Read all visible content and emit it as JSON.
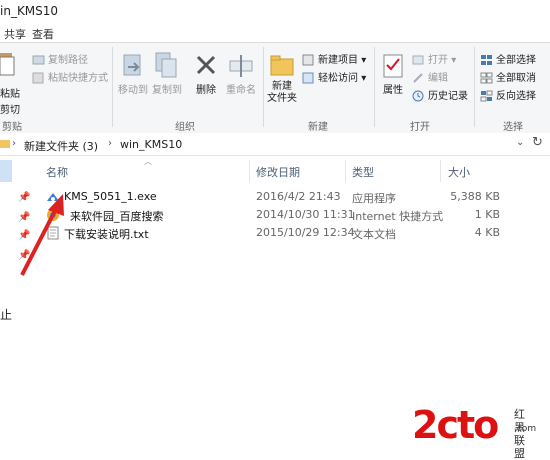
{
  "window": {
    "title": "in_KMS10"
  },
  "menu": {
    "tabs": [
      "共享",
      "查看"
    ]
  },
  "ribbon": {
    "clipboard": {
      "paste_label": "粘贴",
      "cut_label": "剪切",
      "copy_path_label": "复制路径",
      "paste_shortcut_label": "粘贴快捷方式",
      "group_label": "剪贴板"
    },
    "organize": {
      "move_to_label": "移动到",
      "copy_to_label": "复制到",
      "delete_label": "删除",
      "rename_label": "重命名",
      "group_label": "组织"
    },
    "new": {
      "new_folder_label": "新建\n文件夹",
      "new_item_label": "新建项目",
      "easy_access_label": "轻松访问",
      "group_label": "新建"
    },
    "open": {
      "properties_label": "属性",
      "open_label": "打开",
      "edit_label": "编辑",
      "history_label": "历史记录",
      "group_label": "打开"
    },
    "select": {
      "select_all_label": "全部选择",
      "select_none_label": "全部取消",
      "invert_label": "反向选择",
      "group_label": "选择"
    }
  },
  "address": {
    "crumbs": [
      "新建文件夹 (3)",
      "win_KMS10"
    ]
  },
  "columns": {
    "name": "名称",
    "date": "修改日期",
    "type": "类型",
    "size": "大小"
  },
  "files": [
    {
      "name": "KMS_5051_1.exe",
      "date": "2016/4/2 21:43",
      "type": "应用程序",
      "size": "5,388 KB",
      "icon": "kms-exe-icon"
    },
    {
      "name": "来软件园_百度搜索",
      "date": "2014/10/30 11:31",
      "type": "Internet 快捷方式",
      "size": "1 KB",
      "icon": "internet-shortcut-icon"
    },
    {
      "name": "下载安装说明.txt",
      "date": "2015/10/29 12:34",
      "type": "文本文档",
      "size": "4 KB",
      "icon": "text-file-icon"
    }
  ],
  "left_pane": {
    "partial_label": "止"
  },
  "watermark": {
    "main": "2cto",
    "sub": "红黑联盟",
    "sub2": ".com"
  },
  "colors": {
    "accent_red": "#dd2222",
    "ribbon_bg": "#f5f6f7",
    "header_text": "#4c607a"
  }
}
